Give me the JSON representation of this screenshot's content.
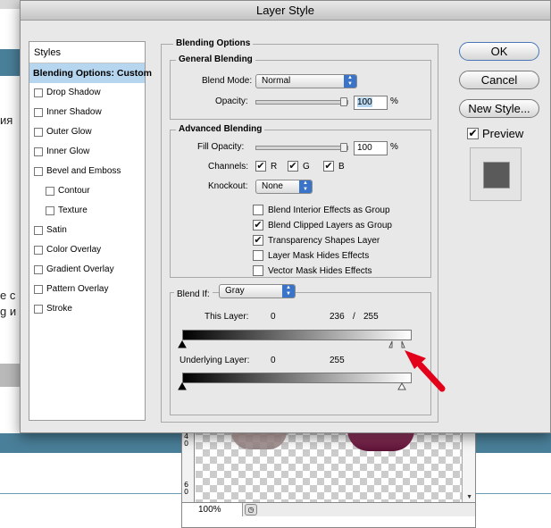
{
  "background": {
    "side_text": [
      "ия",
      "е с",
      "g и"
    ]
  },
  "document": {
    "ruler_marks": [
      "4",
      "0",
      "6",
      "0"
    ],
    "zoom": "100%"
  },
  "dialog": {
    "title": "Layer Style",
    "styles_list": {
      "header": "Styles",
      "items": [
        {
          "label": "Blending Options: Custom",
          "selected": true,
          "checkbox": false,
          "indent": false
        },
        {
          "label": "Drop Shadow",
          "selected": false,
          "checkbox": true,
          "indent": false
        },
        {
          "label": "Inner Shadow",
          "selected": false,
          "checkbox": true,
          "indent": false
        },
        {
          "label": "Outer Glow",
          "selected": false,
          "checkbox": true,
          "indent": false
        },
        {
          "label": "Inner Glow",
          "selected": false,
          "checkbox": true,
          "indent": false
        },
        {
          "label": "Bevel and Emboss",
          "selected": false,
          "checkbox": true,
          "indent": false
        },
        {
          "label": "Contour",
          "selected": false,
          "checkbox": true,
          "indent": true
        },
        {
          "label": "Texture",
          "selected": false,
          "checkbox": true,
          "indent": true
        },
        {
          "label": "Satin",
          "selected": false,
          "checkbox": true,
          "indent": false
        },
        {
          "label": "Color Overlay",
          "selected": false,
          "checkbox": true,
          "indent": false
        },
        {
          "label": "Gradient Overlay",
          "selected": false,
          "checkbox": true,
          "indent": false
        },
        {
          "label": "Pattern Overlay",
          "selected": false,
          "checkbox": true,
          "indent": false
        },
        {
          "label": "Stroke",
          "selected": false,
          "checkbox": true,
          "indent": false
        }
      ]
    },
    "blending_options": {
      "title": "Blending Options",
      "general": {
        "title": "General Blending",
        "blend_mode_label": "Blend Mode:",
        "blend_mode_value": "Normal",
        "opacity_label": "Opacity:",
        "opacity_value": "100",
        "opacity_unit": "%"
      },
      "advanced": {
        "title": "Advanced Blending",
        "fill_opacity_label": "Fill Opacity:",
        "fill_opacity_value": "100",
        "fill_opacity_unit": "%",
        "channels_label": "Channels:",
        "channel_r": "R",
        "channel_g": "G",
        "channel_b": "B",
        "knockout_label": "Knockout:",
        "knockout_value": "None",
        "options": [
          {
            "label": "Blend Interior Effects as Group",
            "checked": false
          },
          {
            "label": "Blend Clipped Layers as Group",
            "checked": true
          },
          {
            "label": "Transparency Shapes Layer",
            "checked": true
          },
          {
            "label": "Layer Mask Hides Effects",
            "checked": false
          },
          {
            "label": "Vector Mask Hides Effects",
            "checked": false
          }
        ]
      },
      "blend_if": {
        "label": "Blend If:",
        "value": "Gray",
        "this_layer_label": "This Layer:",
        "this_layer_low": "0",
        "this_layer_high_a": "236",
        "this_layer_slash": "/",
        "this_layer_high_b": "255",
        "underlying_label": "Underlying Layer:",
        "underlying_low": "0",
        "underlying_high": "255"
      }
    },
    "buttons": {
      "ok": "OK",
      "cancel": "Cancel",
      "new_style": "New Style...",
      "preview_label": "Preview"
    }
  },
  "colors": {
    "selection": "#b6d6ef",
    "accent_band": "#4a7f99",
    "annotation_arrow": "#e3001b"
  }
}
